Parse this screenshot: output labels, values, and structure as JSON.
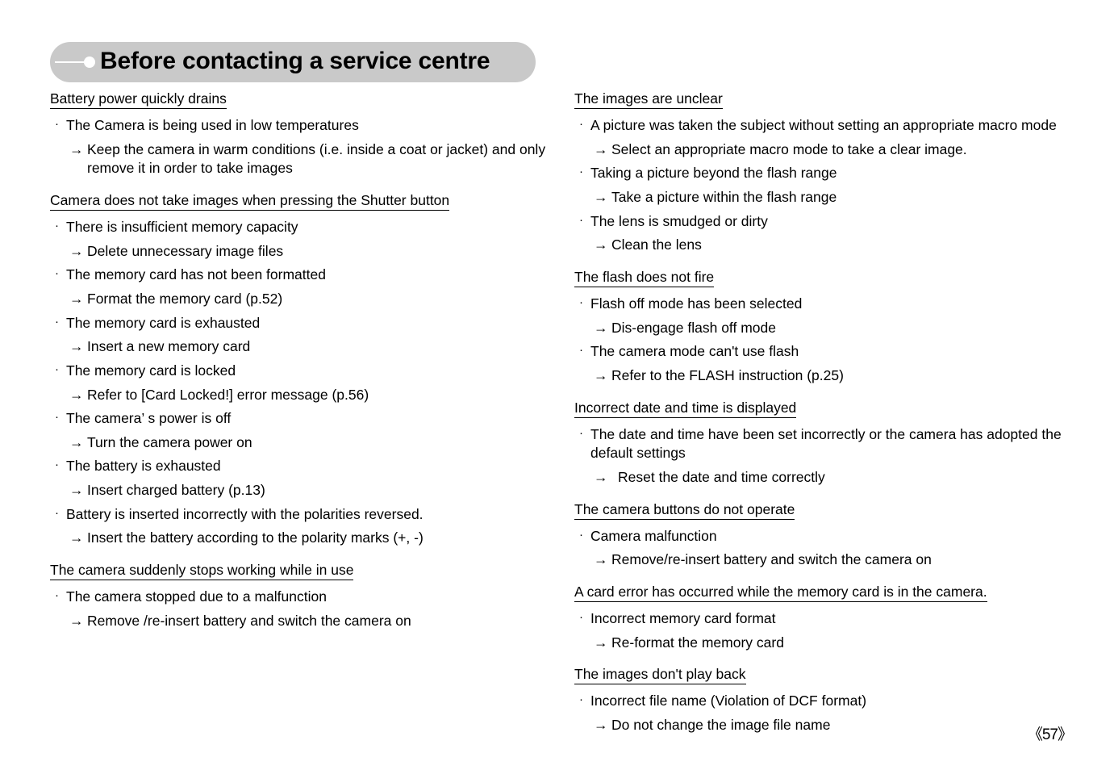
{
  "header": {
    "title": "Before contacting a service centre",
    "marker_icon": "line-dot-marker-icon",
    "pill_color": "#c9c9c9"
  },
  "symbols": {
    "bullet": "·",
    "arrow": "→"
  },
  "left_column": [
    {
      "heading": "Battery power quickly drains",
      "items": [
        {
          "cause": "The Camera is being used in low temperatures",
          "remedies": [
            "Keep the camera in warm conditions (i.e. inside a coat or jacket) and only remove it in order to take images"
          ]
        }
      ]
    },
    {
      "heading": "Camera does not take images when pressing the Shutter button",
      "items": [
        {
          "cause": "There is insufficient memory capacity",
          "remedies": [
            "Delete unnecessary image files"
          ]
        },
        {
          "cause": "The memory card has not been formatted",
          "remedies": [
            "Format the memory card (p.52)"
          ]
        },
        {
          "cause": "The memory card is exhausted",
          "remedies": [
            "Insert a new memory card"
          ]
        },
        {
          "cause": "The memory card is locked",
          "remedies": [
            "Refer to [Card Locked!] error message (p.56)"
          ]
        },
        {
          "cause": "The camera’ s power is off",
          "remedies": [
            "Turn the camera power on"
          ]
        },
        {
          "cause": "The battery is exhausted",
          "remedies": [
            "Insert charged battery (p.13)"
          ]
        },
        {
          "cause": "Battery is inserted incorrectly with the polarities reversed.",
          "remedies": [
            "Insert the battery according to the polarity marks (+, -)"
          ]
        }
      ]
    },
    {
      "heading": "The camera suddenly stops working while in use",
      "items": [
        {
          "cause": "The camera stopped due to a malfunction",
          "remedies": [
            "Remove /re-insert battery and switch the camera on"
          ]
        }
      ]
    }
  ],
  "right_column": [
    {
      "heading": "The images are unclear",
      "items": [
        {
          "cause": "A picture was taken the subject without setting an appropriate macro mode",
          "remedies": [
            "Select an appropriate macro mode to take a clear image."
          ]
        },
        {
          "cause": "Taking a picture beyond the flash range",
          "remedies": [
            "Take a picture within the flash range"
          ]
        },
        {
          "cause": "The lens is smudged or dirty",
          "remedies": [
            "Clean the lens"
          ]
        }
      ]
    },
    {
      "heading": "The flash does not fire",
      "items": [
        {
          "cause": "Flash off mode has been selected",
          "remedies": [
            "Dis-engage flash off mode"
          ]
        },
        {
          "cause": "The camera mode can't use flash",
          "remedies": [
            "Refer to the FLASH instruction (p.25)"
          ]
        }
      ]
    },
    {
      "heading": "Incorrect date and time is displayed",
      "items": [
        {
          "cause": "The date and time have been set incorrectly or the camera has adopted the default settings",
          "remedies": [
            "Reset the date and time correctly"
          ]
        }
      ]
    },
    {
      "heading": "The camera buttons do not operate",
      "items": [
        {
          "cause": "Camera malfunction",
          "remedies": [
            "Remove/re-insert battery and switch the camera on"
          ]
        }
      ]
    },
    {
      "heading": "A card error has occurred while the memory card is in the camera.",
      "items": [
        {
          "cause": "Incorrect memory card format",
          "remedies": [
            "Re-format the memory card"
          ]
        }
      ]
    },
    {
      "heading": "The images don't play back",
      "items": [
        {
          "cause": "Incorrect file name (Violation of DCF format)",
          "remedies": [
            "Do not change the image file name"
          ]
        }
      ]
    }
  ],
  "footer": {
    "page_number": "《57》"
  }
}
